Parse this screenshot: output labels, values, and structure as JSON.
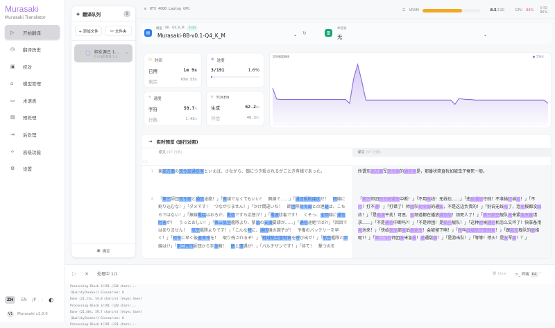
{
  "app": {
    "title": "Murasaki",
    "subtitle": "Murasaki Translator",
    "version_badge": "V1",
    "version": "Murasaki v1.0.0"
  },
  "sidebar": {
    "items": [
      {
        "label": "开始翻译",
        "icon": "play-icon",
        "active": true
      },
      {
        "label": "翻译历史",
        "icon": "clock-icon"
      },
      {
        "label": "校对",
        "icon": "clipboard-check-icon"
      },
      {
        "label": "模型管理",
        "icon": "box-icon"
      },
      {
        "label": "术语表",
        "icon": "book-icon"
      },
      {
        "label": "预处理",
        "icon": "file-icon"
      },
      {
        "label": "后处理",
        "icon": "file-export-icon"
      },
      {
        "label": "高级功能",
        "icon": "sparkles-icon"
      },
      {
        "label": "设置",
        "icon": "gear-icon"
      }
    ],
    "languages": [
      "ZH",
      "EN",
      "JP"
    ],
    "active_language": "ZH"
  },
  "queue": {
    "title": "翻译队列",
    "count": "1",
    "add_file": "+ 添加文件",
    "add_folder": "文件夹",
    "items": [
      {
        "name": "妲女源己 1...",
        "path": "F:\\小说\\测试 1.4..."
      }
    ],
    "footer": "确定"
  },
  "topbar": {
    "gpu": "RTX 4080 Laptop GPU",
    "vram_label": "VRAM",
    "vram_used": "8.5",
    "vram_total": "/12G",
    "vram_fraction": 0.69,
    "gpu_label": "GPU",
    "gpu_value": "94%",
    "vio": "V IO 95%",
    "accent": "#f2a825"
  },
  "model": {
    "label": "模型",
    "tags": [
      "8B",
      "Q4_K_M",
      "5.0G"
    ],
    "name": "Murasaki-8B-v0.1-Q4_K_M",
    "glossary_label": "术语表",
    "glossary_value": "无"
  },
  "stats": {
    "time": {
      "title": "时间",
      "elapsed_label": "已用",
      "elapsed": "1m 9s",
      "remaining_label": "剩余",
      "remaining": "65m 55s"
    },
    "progress": {
      "title": "进度",
      "count": "3/191",
      "percent": "1.6%",
      "fraction": 0.016
    },
    "speed": {
      "title": "速度",
      "chars_label": "字符",
      "chars": "59.7",
      "chars_unit": "/s",
      "lines_label": "行数",
      "lines": "1.43",
      "lines_unit": "/s"
    },
    "token": {
      "title": "TOKEN",
      "gen_label": "生成",
      "gen": "62.2",
      "gen_unit": "t/s",
      "eval_label": "评估",
      "eval": "48.3",
      "eval_unit": "t/s"
    }
  },
  "chart_data": {
    "type": "area",
    "title": "实时速度曲线",
    "legend": "字符/s",
    "color": "#8b6ae0",
    "values": [
      80,
      57,
      56,
      56,
      56,
      56,
      56,
      56,
      56,
      56,
      56,
      56,
      56,
      56,
      56,
      56,
      56,
      56,
      56,
      48,
      100,
      130,
      95,
      55,
      55,
      55,
      55,
      55,
      55,
      55,
      55,
      55,
      55,
      55,
      55,
      55,
      55,
      55,
      55,
      55,
      55,
      55,
      55,
      55,
      55,
      46,
      58,
      57,
      56,
      56,
      55,
      55,
      55,
      55,
      55,
      55,
      55,
      55,
      55,
      55,
      55,
      55,
      55,
      55,
      55,
      55,
      55,
      55,
      48
    ]
  },
  "preview": {
    "title": "实时预览 (逐行对照)",
    "src_label": "原文",
    "src_sub": "(97 行数)",
    "tgt_label": "译文",
    "tgt_sub": "(97 行数)",
    "marker": "[ ]",
    "src": [
      [
        [
          "東"
        ],
        [
          "部方面",
          "b"
        ],
        [
          "の"
        ],
        [
          "司令部通信室",
          "b"
        ],
        [
          "といえば、さながら、蜘につき殺されるがごとき有様であった。"
        ]
      ],
      [
        [
          "「"
        ],
        [
          "第三",
          "b"
        ],
        [
          "師団"
        ],
        [
          "司令部",
          "b"
        ],
        [
          "と"
        ],
        [
          "通信",
          "b"
        ],
        [
          "途絶！」「"
        ],
        [
          "有",
          "b"
        ],
        [
          "線でなくてもいい！　無線で……」「"
        ],
        [
          "通信",
          "b"
        ],
        [
          "規則違反",
          "b"
        ],
        [
          "だ！　"
        ],
        [
          "回",
          "b"
        ],
        [
          "線に割り込むな！」「ダメです！　つながりません！」「かけ間違いだ！　師"
        ],
        [
          "団",
          "b"
        ],
        [
          "隊"
        ],
        [
          "司令部",
          "b"
        ],
        [
          "との連"
        ],
        [
          "絡",
          "b"
        ],
        [
          "は、こちらではない！」「無線"
        ],
        [
          "電話",
          "b"
        ],
        [
          "はおろか、"
        ],
        [
          "電信",
          "b"
        ],
        [
          "ですら応答が！」「"
        ],
        [
          "電波",
          "b"
        ],
        [
          "妨害です！　くそっ、"
        ],
        [
          "全回",
          "b"
        ],
        [
          "線に"
        ],
        [
          "通信阻害",
          "b"
        ],
        [
          "が！　うっとおしい！」「"
        ],
        [
          "第三航空",
          "b"
        ],
        [
          "艦隊より、緊"
        ],
        [
          "急",
          "b"
        ],
        [
          "の"
        ],
        [
          "支援",
          "b"
        ],
        [
          "要請が……」「"
        ],
        [
          "通信",
          "b"
        ],
        [
          "途絶では?!」「回回ではありません！　"
        ],
        [
          "航空",
          "b"
        ],
        [
          "艦隊よりです！」「こんな"
        ],
        [
          "時",
          "b"
        ],
        [
          "に、"
        ],
        [
          "通信",
          "b"
        ],
        [
          "機の調子が！　予備のバッテリーを早く！」「"
        ],
        [
          "司令",
          "b"
        ],
        [
          "に早く後"
        ],
        [
          "退",
          "b"
        ],
        [
          "命令",
          "b"
        ],
        [
          "を！　取り残されるぞ！」「"
        ],
        [
          "戦域航空管制官",
          "b"
        ],
        [
          "を"
        ],
        [
          "呼",
          "b"
        ],
        [
          "び出せ！」「"
        ],
        [
          "航空",
          "b"
        ],
        [
          "艦隊と"
        ],
        [
          "回",
          "b"
        ],
        [
          "線は!?」「"
        ],
        [
          "第二飛行",
          "b"
        ],
        [
          "師団から至"
        ],
        [
          "急",
          "b"
        ],
        [
          "報！　"
        ],
        [
          "敵",
          "b"
        ],
        [
          "と"
        ],
        [
          "遭",
          "b"
        ],
        [
          "遇が！」「パルチザンです！」「待て！　撃つのを"
        ]
      ]
    ],
    "tgt": [
      [
        [
          "所谓东"
        ],
        [
          "部方面",
          "p"
        ],
        [
          "军"
        ],
        [
          "司令部",
          "p"
        ],
        [
          "的"
        ],
        [
          "通信室",
          "p"
        ],
        [
          "是，那番状简直犹如被虫子蚕死一般。"
        ]
      ],
      [
        [
          "「"
        ],
        [
          "第三",
          "p"
        ],
        [
          "师团"
        ],
        [
          "司令部通信",
          "p"
        ],
        [
          "中断！」「不用"
        ],
        [
          "有",
          "p"
        ],
        [
          "线！无线也……」「违"
        ],
        [
          "反通信",
          "p"
        ],
        [
          "守则！不准插"
        ],
        [
          "行",
          "p"
        ],
        [
          "插"
        ],
        [
          "话",
          "p"
        ],
        [
          "！」「不"
        ],
        [
          "行",
          "p"
        ],
        [
          "！打不"
        ],
        [
          "通",
          "p"
        ],
        [
          "！」「打错了！师"
        ],
        [
          "团",
          "p"
        ],
        [
          "队"
        ],
        [
          "司令部",
          "p"
        ],
        [
          "的通"
        ],
        [
          "知",
          "p"
        ],
        [
          "，不是这边负责的！」「别说无线"
        ],
        [
          "电",
          "p"
        ],
        [
          "了，连"
        ],
        [
          "电",
          "p"
        ],
        [
          "报都没"
        ],
        [
          "回",
          "p"
        ],
        [
          "应！」「是"
        ],
        [
          "电波",
          "p"
        ],
        [
          "干扰！可恶，"
        ],
        [
          "全",
          "p"
        ],
        [
          "频道都在播放"
        ],
        [
          "通信阻",
          "p"
        ],
        [
          "！烦死人了！」「"
        ],
        [
          "第三航空",
          "p"
        ],
        [
          "舰队"
        ],
        [
          "发",
          "p"
        ],
        [
          "来紧"
        ],
        [
          "急支援",
          "p"
        ],
        [
          "请求……」「不是"
        ],
        [
          "通信",
          "p"
        ],
        [
          "中断吗?！」「不是师团！是"
        ],
        [
          "航空",
          "p"
        ],
        [
          "舰队！」「这种"
        ],
        [
          "时",
          "p"
        ],
        [
          "候"
        ],
        [
          "通信",
          "p"
        ],
        [
          "机怎么又坏了！快拿备用"
        ],
        [
          "电",
          "p"
        ],
        [
          "池来！」「快给"
        ],
        [
          "司令",
          "p"
        ],
        [
          "部"
        ],
        [
          "发",
          "p"
        ],
        [
          "后"
        ],
        [
          "退命令",
          "p"
        ],
        [
          "！会被留下啊！」「"
        ],
        [
          "呼",
          "p"
        ],
        [
          "叫"
        ],
        [
          "战域航空管制官",
          "p"
        ],
        [
          "！」「跟"
        ],
        [
          "航空",
          "p"
        ],
        [
          "舰队的"
        ],
        [
          "联",
          "p"
        ],
        [
          "络呢?！」「"
        ],
        [
          "第二飞行",
          "p"
        ],
        [
          "师团"
        ],
        [
          "发",
          "p"
        ],
        [
          "来急"
        ],
        [
          "报",
          "p"
        ],
        [
          "！"
        ],
        [
          "遭",
          "p"
        ],
        [
          "遇敌"
        ],
        [
          "袭",
          "p"
        ],
        [
          "！」「是游击队！」「等等！停火！是"
        ],
        [
          "友",
          "p"
        ],
        [
          "军"
        ],
        [
          "袭",
          "p"
        ],
        [
          "！？」"
        ]
      ]
    ]
  },
  "bottom": {
    "status": "处理中 1/1",
    "clear": "Clear",
    "console": "终端",
    "console_count": "64",
    "log": [
      "Processing Block 3/191 (134 chars)...",
      "[QualityChecker] Glossaries: 0",
      "Done (21.21s, 54.0 chars/s) [Async Save]",
      "Processing Block 3/191 (120 chars)...",
      "Done (21.40s, 59.7 chars/s) [Async Save]",
      "[QualityChecker] Glossaries: 0",
      "Processing Block 4/191 (121 chars)..."
    ]
  }
}
